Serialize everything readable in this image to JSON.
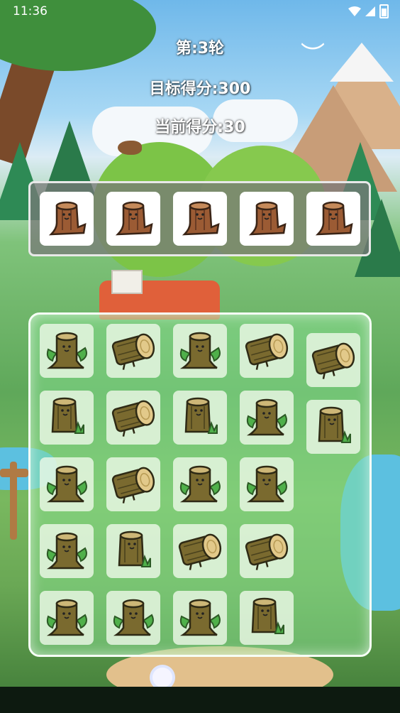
{
  "status_bar": {
    "time": "11:36"
  },
  "header": {
    "round": "第:3轮",
    "target_score": "目标得分:300",
    "current_score": "当前得分:30"
  },
  "colors": {
    "tray_bg": "#7f7f7f",
    "board_bg": "#8ce696",
    "wood": "#9b5b34",
    "wood_light": "#c68a5a",
    "stump_olive": "#7a6a2f",
    "leaf": "#4fb04a",
    "log_face": "#e2c98a"
  },
  "tray": {
    "slots": [
      {
        "icon": "brown-stump-icon"
      },
      {
        "icon": "brown-stump-icon"
      },
      {
        "icon": "brown-stump-icon"
      },
      {
        "icon": "brown-stump-icon"
      },
      {
        "icon": "brown-stump-icon"
      }
    ]
  },
  "board": {
    "rows": [
      [
        "leafy-stump-icon",
        "log-icon",
        "leafy-stump-icon",
        "log-icon",
        "log-icon"
      ],
      [
        "grass-stump-icon",
        "log-icon",
        "grass-stump-icon",
        "leafy-stump-icon",
        "grass-stump-icon"
      ],
      [
        "leafy-stump-icon",
        "log-icon",
        "leafy-stump-icon",
        "leafy-stump-icon"
      ],
      [
        "leafy-stump-icon",
        "grass-stump-icon",
        "log-icon",
        "log-icon"
      ],
      [
        "leafy-stump-icon",
        "leafy-stump-icon",
        "leafy-stump-icon",
        "grass-stump-icon"
      ]
    ]
  }
}
